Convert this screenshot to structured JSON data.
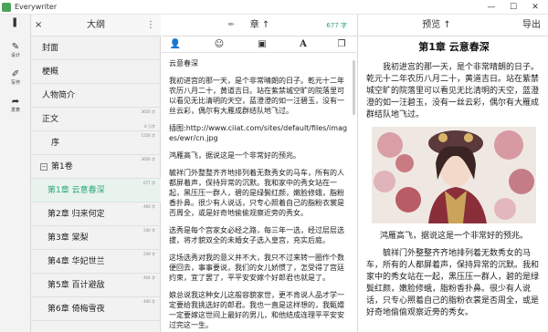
{
  "window": {
    "title": "Everywriter",
    "minimize": "—",
    "maximize": "☐",
    "close": "✕"
  },
  "toolbar": {
    "top_icon": "❚",
    "items": [
      {
        "label": "设计",
        "icon": "pen-icon"
      },
      {
        "label": "写作",
        "icon": "write-icon"
      },
      {
        "label": "发表",
        "icon": "share-icon"
      }
    ]
  },
  "outline": {
    "title": "大纲",
    "close": "×",
    "menu": "⋮",
    "items": [
      {
        "label": "封面",
        "active": false
      },
      {
        "label": "梗概",
        "active": false
      },
      {
        "label": "人物简介",
        "active": false
      },
      {
        "label": "正文",
        "count1": "3656 字",
        "count2": "8 万字",
        "active": false
      },
      {
        "label": "序",
        "count1": "1556 字",
        "active": false
      },
      {
        "label": "第1卷",
        "expander": "−",
        "count1": "3656 字",
        "active": false
      },
      {
        "label": "第1章 云意春深",
        "count1": "677 字",
        "active": true
      },
      {
        "label": "第2章 归来何定",
        "count1": "466 字",
        "active": false
      },
      {
        "label": "第3章 棠梨",
        "count1": "540 字",
        "active": false
      },
      {
        "label": "第4章 华妃世兰",
        "count1": "549 字",
        "active": false
      },
      {
        "label": "第5章 百计避敌",
        "count1": "404 字",
        "active": false
      },
      {
        "label": "第6章 倚梅雪夜",
        "count1": "400 字",
        "active": false
      }
    ]
  },
  "editor": {
    "chapter_label": "章 ↑",
    "word_count": "677 字",
    "tools": {
      "person": "👤",
      "emoji": "☺",
      "image": "▣",
      "font": "A",
      "copy": "❐"
    },
    "lines": [
      "云意春深",
      "我初进宫的那一天，是个非常晴朗的日子。乾元十二年农历八月二十，黄道吉日。站在紫禁城空旷的院落里可以看见无比清明的天空，蓝澄澄的如一汪碧玉，没有一丝云彩，偶尔有大雁成群结队地飞过。",
      "插图:http://www.ciiat.com/sites/default/files/images/ewr/cn.jpg",
      "鸿雁高飞，据说这是一个非常好的预兆。",
      "毓祥门外整整齐齐地排列着无数秀女的马车，所有的人都屏着声，保持异常的沉默。我和家中的秀女站在一起，黑压压一群人，碧的是绿鬓红颜，嫩脸修蛾，脂粉香扑鼻。很少有人说话，只专心照着自己的脂粉衣裳是否周全，或是好奇地偷偷观察近旁的秀女。",
      "选秀是每个宫家女必经之路，每三年一选，经过层层选拔，将才貌双全的未婚女子选入皇宫，充实后庭。",
      "这场选秀对我的意义并不大，我只不过来转一圈作个数便回去，事事要说，我们的女儿娇惯了，怎受得了宫廷约束，宜了罢了，平平安安嫁个好郎君也就是了。",
      "娘总说我这种女儿这般容貌家世，更不肯说人品才学一定要给我挑选好的郎君。我也一直是这样想的，我甄嬛一定要嫁这世间上最好的男儿，和他结成连理平平安安过完这一生。"
    ]
  },
  "preview": {
    "title": "预览 ↑",
    "export": "导出",
    "heading": "第1章 云意春深",
    "paragraphs": [
      "我初进宫的那一天，是个非常晴朗的日子。乾元十二年农历八月二十，黄道吉日。站在紫禁城空旷的院落里可以看见无比清明的天空，蓝澄澄的如一汪碧玉，没有一丝云彩，偶尔有大雁成群结队地飞过。",
      "鸿雁高飞，据说这是一个非常好的预兆。",
      "毓祥门外整整齐齐地排列着无数秀女的马车，所有的人都屏着声，保持异常的沉默。我和家中的秀女站在一起，黑压压一群人，碧的是绿鬓红颜，嫩脸修蛾，脂粉香扑鼻。很少有人说话，只专心照着自己的脂粉衣裳是否周全，或是好奇地偷偷观察近旁的秀女。"
    ]
  },
  "colors": {
    "accent": "#2aa775",
    "active_bg": "#e8f3ee",
    "panel_bg": "#f2f2f2"
  }
}
